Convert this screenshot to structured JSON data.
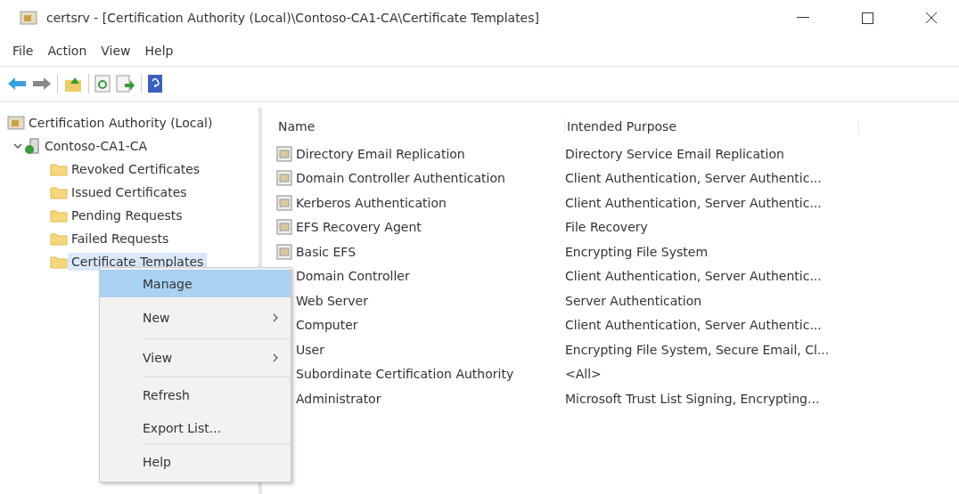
{
  "window": {
    "title": "certsrv - [Certification Authority (Local)\\Contoso-CA1-CA\\Certificate Templates]"
  },
  "menu_bar": [
    "File",
    "Action",
    "View",
    "Help"
  ],
  "tree": {
    "label": "Certification Authority (Local)",
    "selected": false,
    "children": [
      {
        "label": "Contoso-CA1-CA",
        "selected": false,
        "expanded": true,
        "children": [
          {
            "label": "Revoked Certificates",
            "selected": false
          },
          {
            "label": "Issued Certificates",
            "selected": false
          },
          {
            "label": "Pending Requests",
            "selected": false
          },
          {
            "label": "Failed Requests",
            "selected": false
          },
          {
            "label": "Certificate Templates",
            "selected": true
          }
        ]
      }
    ]
  },
  "table": {
    "columns": [
      "Name",
      "Intended Purpose"
    ],
    "rows": [
      {
        "icon": true,
        "cells": [
          "Directory Email Replication",
          "Directory Service Email Replication"
        ]
      },
      {
        "icon": true,
        "cells": [
          "Domain Controller Authentication",
          "Client Authentication, Server Authentic..."
        ]
      },
      {
        "icon": true,
        "cells": [
          "Kerberos Authentication",
          "Client Authentication, Server Authentic..."
        ]
      },
      {
        "icon": true,
        "cells": [
          "EFS Recovery Agent",
          "File Recovery"
        ]
      },
      {
        "icon": true,
        "cells": [
          "Basic EFS",
          "Encrypting File System"
        ]
      },
      {
        "icon": false,
        "cells": [
          "Domain Controller",
          "Client Authentication, Server Authentic..."
        ]
      },
      {
        "icon": false,
        "cells": [
          "Web Server",
          "Server Authentication"
        ]
      },
      {
        "icon": false,
        "cells": [
          "Computer",
          "Client Authentication, Server Authentic..."
        ]
      },
      {
        "icon": false,
        "cells": [
          "User",
          "Encrypting File System, Secure Email, Cl..."
        ]
      },
      {
        "icon": false,
        "cells": [
          "Subordinate Certification Authority",
          "<All>"
        ]
      },
      {
        "icon": false,
        "cells": [
          "Administrator",
          "Microsoft Trust List Signing, Encrypting..."
        ]
      }
    ]
  },
  "context_menu": [
    {
      "kind": "item",
      "label": "Manage",
      "selected": true,
      "submenu": false
    },
    {
      "kind": "item",
      "label": "New",
      "selected": false,
      "submenu": true
    },
    {
      "kind": "separator"
    },
    {
      "kind": "item",
      "label": "View",
      "selected": false,
      "submenu": true
    },
    {
      "kind": "separator"
    },
    {
      "kind": "item",
      "label": "Refresh",
      "selected": false,
      "submenu": false
    },
    {
      "kind": "item",
      "label": "Export List...",
      "selected": false,
      "submenu": false
    },
    {
      "kind": "separator"
    },
    {
      "kind": "item",
      "label": "Help",
      "selected": false,
      "submenu": false
    }
  ]
}
